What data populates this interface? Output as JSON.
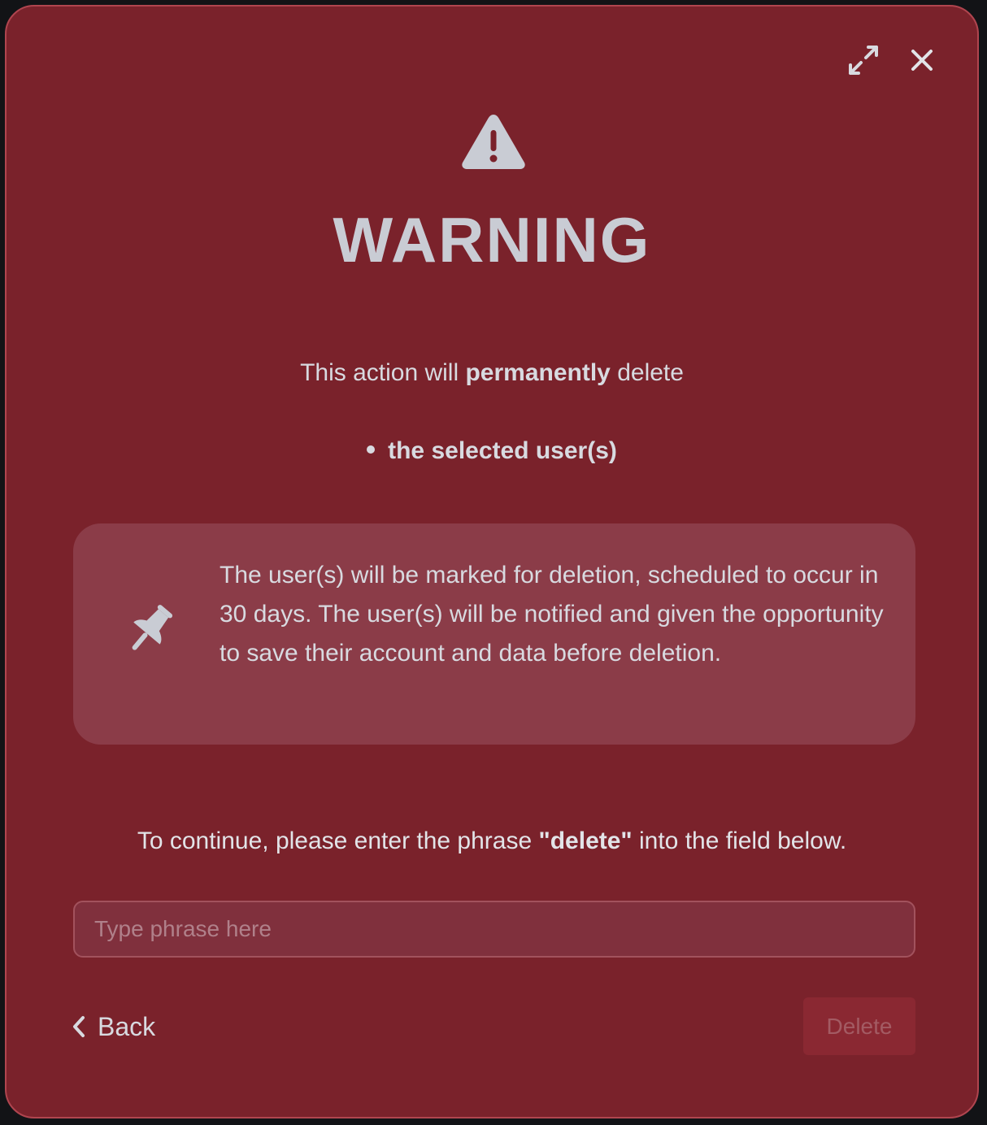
{
  "modal": {
    "title": "WARNING",
    "lead": {
      "prefix": "This action will ",
      "emphasis": "permanently",
      "suffix": " delete"
    },
    "bullets": [
      "the selected user(s)"
    ],
    "info": "The user(s) will be marked for deletion, scheduled to occur in 30 days. The user(s) will be notified and given the opportunity to save their account and data before deletion.",
    "instruction": {
      "prefix": "To continue, please enter the phrase ",
      "phrase": "\"delete\"",
      "suffix": " into the field below."
    },
    "input": {
      "placeholder": "Type phrase here",
      "value": ""
    },
    "back_label": "Back",
    "delete_label": "Delete",
    "icons": {
      "expand": "expand-icon",
      "close": "close-icon",
      "warning": "warning-triangle-icon",
      "pin": "pushpin-icon",
      "back": "chevron-left-icon"
    },
    "colors": {
      "background": "#7a222b",
      "info_box": "#8b3c48",
      "text": "#c9ccd4",
      "delete_disabled": "#8a2832"
    }
  }
}
